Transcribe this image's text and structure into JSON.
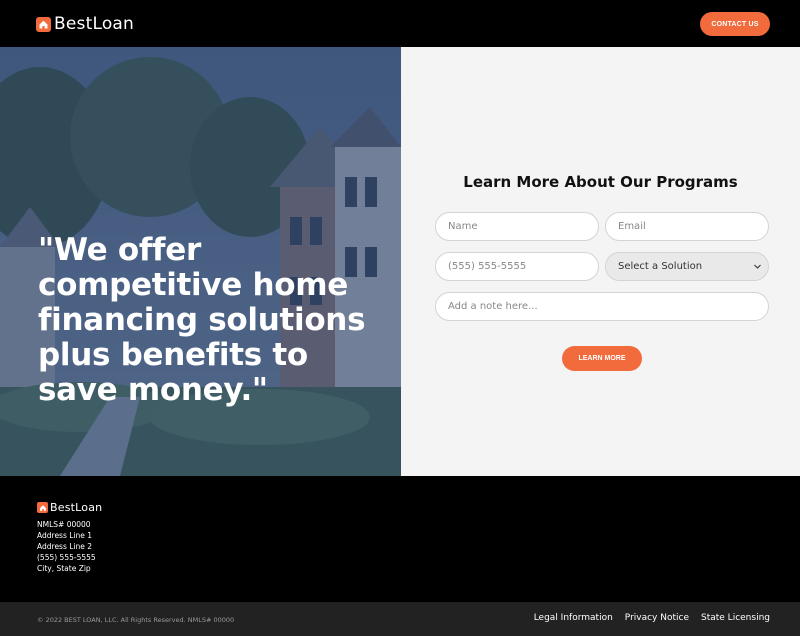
{
  "header": {
    "logo_text": "BestLoan",
    "contact_label": "CONTACT US"
  },
  "hero": {
    "quote": "\"We offer competitive home financing solutions plus benefits to save money.\""
  },
  "form": {
    "title": "Learn More About Our Programs",
    "name_placeholder": "Name",
    "email_placeholder": "Email",
    "phone_placeholder": "(555) 555-5555",
    "solution_value": "Select a Solution",
    "note_placeholder": "Add a note here...",
    "submit_label": "LEARN MORE"
  },
  "footer": {
    "logo_text": "BestLoan",
    "lines": [
      "NMLS# 00000",
      "Address Line 1",
      "Address Line 2",
      "(555) 555-5555",
      "City, State Zip"
    ],
    "copyright": "© 2022 BEST LOAN, LLC. All Rights Reserved. NMLS# 00000",
    "links": [
      "Legal Information",
      "Privacy Notice",
      "State Licensing"
    ]
  },
  "colors": {
    "accent": "#f16b3c",
    "header_bg": "#000000",
    "form_bg": "#f4f4f4",
    "hero_overlay": "#1f3a6b"
  },
  "icons": {
    "logo": "house-icon",
    "select": "chevron-down-icon"
  }
}
